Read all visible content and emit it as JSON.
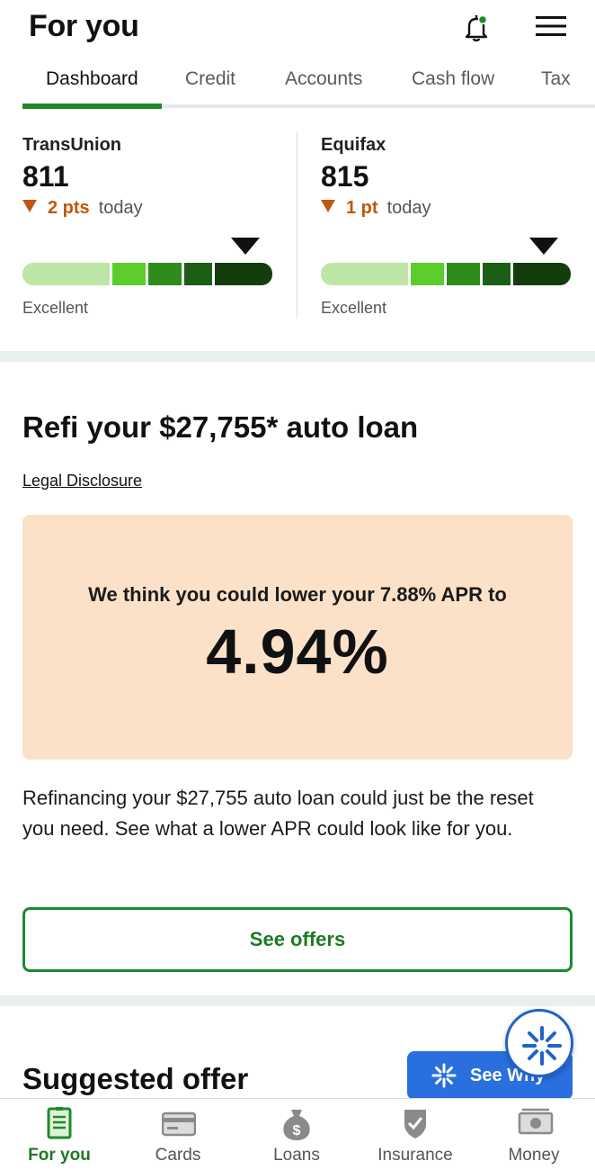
{
  "header": {
    "title": "For you"
  },
  "tabs": [
    {
      "label": "Dashboard",
      "active": true
    },
    {
      "label": "Credit"
    },
    {
      "label": "Accounts"
    },
    {
      "label": "Cash flow"
    },
    {
      "label": "Tax"
    }
  ],
  "credit": {
    "bureaus": [
      {
        "name": "TransUnion",
        "score": "811",
        "change": "2 pts",
        "change_direction": "down",
        "when": "today",
        "rating": "Excellent"
      },
      {
        "name": "Equifax",
        "score": "815",
        "change": "1 pt",
        "change_direction": "down",
        "when": "today",
        "rating": "Excellent"
      }
    ]
  },
  "refi": {
    "title": "Refi your  $27,755* auto loan",
    "legal_link": "Legal Disclosure",
    "apr_line": "We think you could lower your 7.88% APR to",
    "apr_value": "4.94%",
    "body": "Refinancing your $27,755 auto loan could just be the reset you need. See what a lower APR could look like for you.",
    "cta": "See offers"
  },
  "suggested": {
    "title": "Suggested offer",
    "see_why_label": "See Why"
  },
  "bottom_nav": [
    {
      "label": "For you",
      "icon": "document-icon",
      "active": true
    },
    {
      "label": "Cards",
      "icon": "credit-card-icon"
    },
    {
      "label": "Loans",
      "icon": "money-bag-icon"
    },
    {
      "label": "Insurance",
      "icon": "shield-check-icon"
    },
    {
      "label": "Money",
      "icon": "cash-icon"
    }
  ],
  "colors": {
    "brand_green": "#1e8a2c",
    "down_orange": "#c0570e",
    "card_peach": "#fbe1c7",
    "fab_blue": "#2a6fde"
  }
}
